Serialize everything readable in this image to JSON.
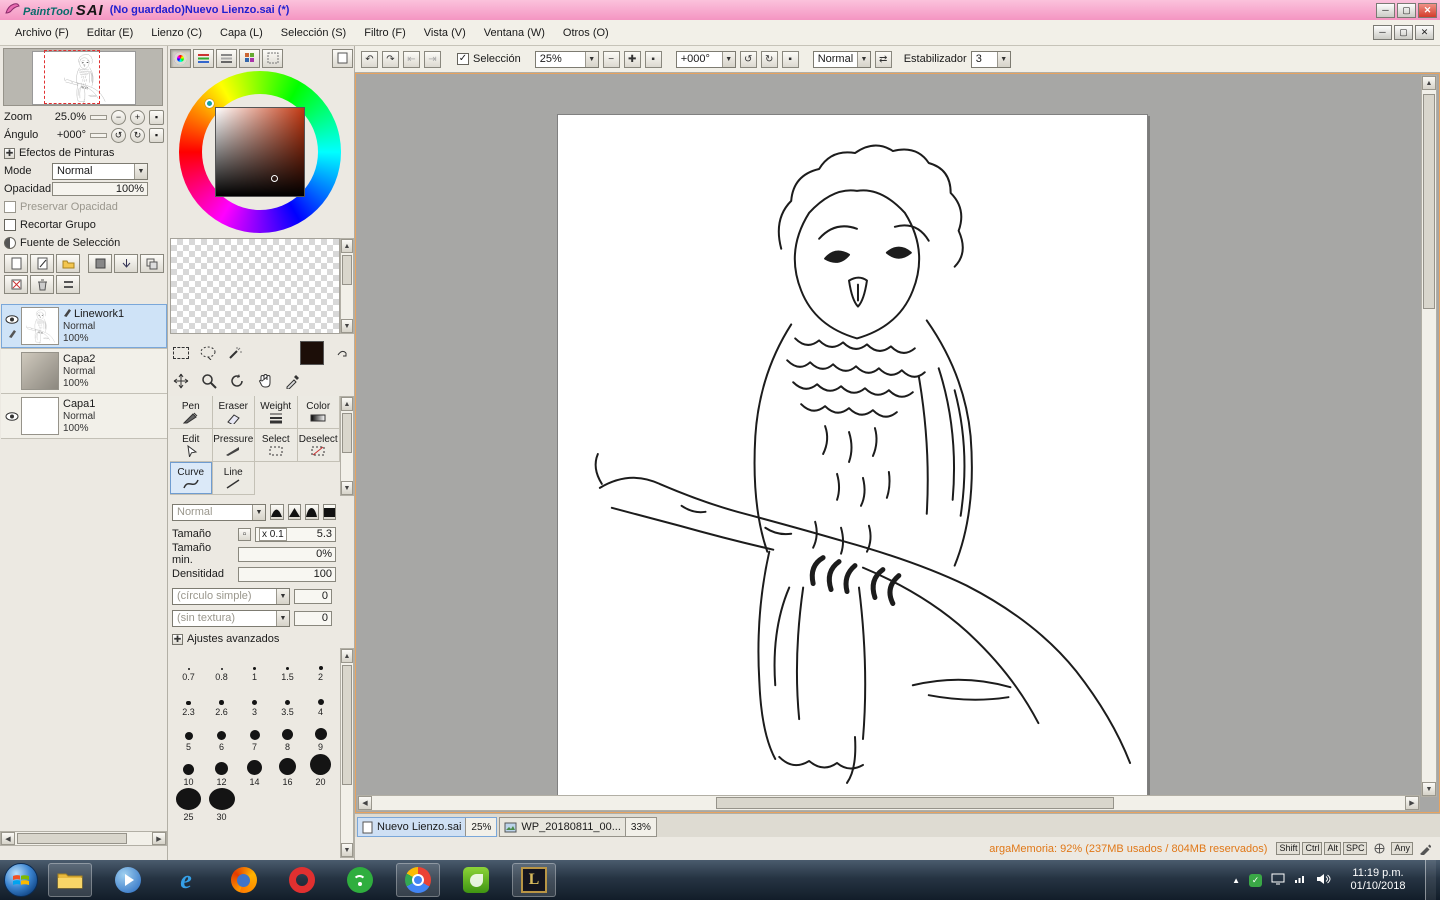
{
  "window": {
    "app_name": "PaintTool",
    "app_name2": "SAI",
    "doc_title": "(No guardado)Nuevo Lienzo.sai (*)"
  },
  "menu": {
    "items": [
      "Archivo (F)",
      "Editar (E)",
      "Lienzo (C)",
      "Capa (L)",
      "Selección (S)",
      "Filtro (F)",
      "Vista (V)",
      "Ventana (W)",
      "Otros (O)"
    ]
  },
  "toolbar": {
    "selection_label": "Selección",
    "zoom_value": "25%",
    "angle_value": "+000°",
    "mode_value": "Normal",
    "stabilizer_label": "Estabilizador",
    "stabilizer_value": "3"
  },
  "navigator": {
    "zoom_label": "Zoom",
    "zoom_value": "25.0%",
    "angle_label": "Ángulo",
    "angle_value": "+000°"
  },
  "effects": {
    "header": "Efectos de Pinturas",
    "mode_label": "Mode",
    "mode_value": "Normal",
    "opacity_label": "Opacidad",
    "opacity_value": "100%",
    "checkbox1": "Preservar Opacidad",
    "checkbox2": "Recortar Grupo",
    "radio1": "Fuente de Selección"
  },
  "layers": {
    "items": [
      {
        "name": "Linework1",
        "mode": "Normal",
        "opacity": "100%",
        "selected": true,
        "visible": true,
        "type": "linework"
      },
      {
        "name": "Capa2",
        "mode": "Normal",
        "opacity": "100%",
        "selected": false,
        "visible": false,
        "type": "photo"
      },
      {
        "name": "Capa1",
        "mode": "Normal",
        "opacity": "100%",
        "selected": false,
        "visible": true,
        "type": "blank"
      }
    ]
  },
  "tools": {
    "cells": [
      {
        "label": "Pen",
        "icon": "pen"
      },
      {
        "label": "Eraser",
        "icon": "eraser"
      },
      {
        "label": "Weight",
        "icon": "weight"
      },
      {
        "label": "Color",
        "icon": "color"
      },
      {
        "label": "Edit",
        "icon": "edit"
      },
      {
        "label": "Pressure",
        "icon": "pressure"
      },
      {
        "label": "Select",
        "icon": "select"
      },
      {
        "label": "Deselect",
        "icon": "deselect"
      },
      {
        "label": "Curve",
        "icon": "curve",
        "selected": true
      },
      {
        "label": "Line",
        "icon": "line"
      }
    ]
  },
  "brush": {
    "mode_value": "Normal",
    "size_label": "Tamaño",
    "size_unit": "x 0.1",
    "size_value": "5.3",
    "min_label": "Tamaño min.",
    "min_value": "0%",
    "density_label": "Densitidad",
    "density_value": "100",
    "shape_value": "(círculo simple)",
    "shape_num": "0",
    "texture_value": "(sin textura)",
    "texture_num": "0",
    "advanced_label": "Ajustes avanzados"
  },
  "brush_sizes": {
    "values": [
      0.7,
      0.8,
      1,
      1.5,
      2,
      2.3,
      2.6,
      3,
      3.5,
      4,
      5,
      6,
      7,
      8,
      9,
      10,
      12,
      14,
      16,
      20,
      25,
      30
    ]
  },
  "doc_tabs": {
    "items": [
      {
        "name": "Nuevo Lienzo.sai",
        "zoom": "25%",
        "active": true
      },
      {
        "name": "WP_20180811_00...",
        "zoom": "33%",
        "active": false
      }
    ]
  },
  "status": {
    "memory": "argaMemoria: 92% (237MB usados / 804MB reservados)",
    "keys": [
      "Shift",
      "Ctrl",
      "Alt",
      "SPC"
    ],
    "any_label": "Any"
  },
  "taskbar": {
    "icons": [
      "explorer",
      "media-player",
      "internet-explorer",
      "firefox",
      "opera",
      "wifi-app",
      "chrome",
      "green-app",
      "league-of-legends"
    ],
    "open_icons": [
      "explorer",
      "chrome",
      "league-of-legends"
    ],
    "tray_time": "11:19 p.m.",
    "tray_date": "01/10/2018"
  }
}
